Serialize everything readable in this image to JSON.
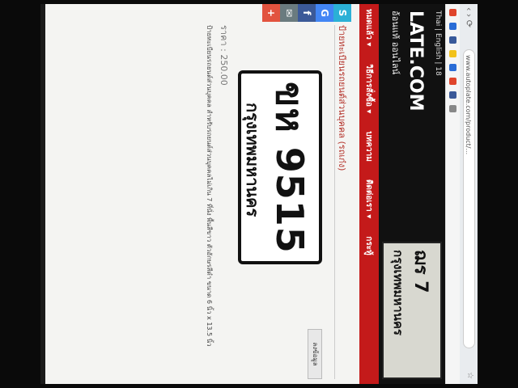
{
  "browser": {
    "url": "www.autoplate.com/product/...",
    "navbtns": "‹ › ⟳"
  },
  "site": {
    "lang": "Thai | English | 18",
    "logo": "LATE.COM",
    "tagline": "อ้อนแท้ ออนไลน์",
    "banner_line1": "ฌร 7",
    "banner_line2": "กรุงเทพมหานคร"
  },
  "nav": {
    "items": [
      "หมดแล้ว ▾",
      "วิธีการสั่งซื้อ ▾",
      "บทความ",
      "ติดต่อเรา ▾",
      "กระทู้"
    ]
  },
  "social": [
    "S",
    "G",
    "f",
    "✉",
    "+"
  ],
  "product": {
    "title": "ป้ายทะเบียนรถยนต์ส่วนบุคคล (รถเก๋ง)",
    "plate_number": "ขห 9515",
    "plate_province": "กรุงเทพมหานคร",
    "price": "ราคา : 250.00",
    "side_button": "ลงข้อมูล",
    "details": "ป้ายทะเบียนรถยนต์ส่วนบุคคล สำหรับรถยนต์ส่วนบุคคลไม่เกิน 7 ที่นั่ง พื้นสีขาว ตัวอักษรสีดำ ขนาด 6 นิ้ว x 13.5 นิ้ว"
  },
  "colors": {
    "nav_red": "#c41a1a",
    "title_red": "#b4342c"
  }
}
